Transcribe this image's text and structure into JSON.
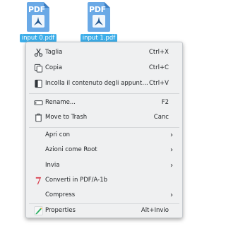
{
  "files": [
    {
      "label": "input 0.pdf",
      "badge": "PDF"
    },
    {
      "label": "input 1.pdf",
      "badge": "PDF"
    }
  ],
  "menu": {
    "items": [
      {
        "label": "Taglia",
        "shortcut": "Ctrl+X",
        "icon": "scissors-icon"
      },
      {
        "label": "Copia",
        "shortcut": "Ctrl+C",
        "icon": "copy-icon"
      },
      {
        "label": "Incolla il contenuto degli appunti...",
        "shortcut": "Ctrl+V",
        "icon": "paste-icon"
      },
      {
        "label": "Rename...",
        "shortcut": "F2",
        "icon": "rename-icon"
      },
      {
        "label": "Move to Trash",
        "shortcut": "Canc",
        "icon": "trash-icon"
      },
      {
        "label": "Apri con",
        "shortcut": "",
        "icon": "",
        "submenu": "›"
      },
      {
        "label": "Azioni come Root",
        "shortcut": "",
        "icon": "",
        "submenu": "›"
      },
      {
        "label": "Invia",
        "shortcut": "",
        "icon": "",
        "submenu": "›"
      },
      {
        "label": "Converti in PDF/A-1b",
        "shortcut": "",
        "icon": "convert-pdf-icon"
      },
      {
        "label": "Compress",
        "shortcut": "",
        "icon": "",
        "submenu": "›"
      },
      {
        "label": "Properties",
        "shortcut": "Alt+Invio",
        "icon": "properties-icon"
      }
    ]
  },
  "colors": {
    "selection": "#3daee9",
    "menu_bg": "#eff0f1",
    "text": "#232629",
    "convert_icon": "#da4453"
  }
}
